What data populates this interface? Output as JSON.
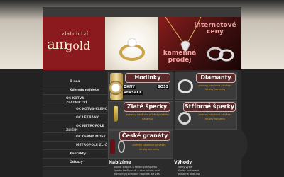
{
  "header": {
    "logo_small": "zlatnictví",
    "logo_am": "am",
    "logo_gold": "gold",
    "promo_line1": "internetové",
    "promo_line2": "ceny",
    "promo_line3": "kamenná",
    "promo_line4": "prodej"
  },
  "nav": {
    "items": [
      {
        "label": "O nás"
      },
      {
        "label": "Kde nás najdete"
      },
      {
        "label": "OC KOTVA-"
      },
      {
        "label": "ZLATNICTVÍ"
      },
      {
        "label": "OC KOTVA-KLENOTY"
      },
      {
        "label": "OC LETŇANY"
      },
      {
        "label": "OC METROPOLE"
      },
      {
        "label": "ZLIČÍN"
      },
      {
        "label": "OC ČERNÝ MOST"
      },
      {
        "label": "METROPOLE ZLIČÍN"
      },
      {
        "label": "Kontakty"
      },
      {
        "label": "Odkazy"
      }
    ]
  },
  "cards": {
    "hodinky": {
      "title": "Hodinky"
    },
    "diamanty": {
      "title": "Diamanty",
      "links": "prsteny  náušnice  přívěsky  řetízky  náramky"
    },
    "zlate": {
      "title": "Zlaté šperky",
      "links": "prsteny  náušnice  přívěsky  řetízky  náramky"
    },
    "stribrne": {
      "title": "Stříbrné šperky",
      "links": "prsteny  náušnice  přívěsky  řetízky  náramky"
    },
    "ceske": {
      "title": "České granáty",
      "links": "prsteny  náušnice  přívěsky  řetízky  náramky"
    }
  },
  "brands": [
    "DKNY",
    "BOSS",
    "VERSACE"
  ],
  "bottom": {
    "nabizime_title": "Nabízíme",
    "nabizime_lines": [
      "prodej zlatých a stříbrných šperků",
      "šperky ke škrtnutí a chirurgické oceli",
      "diamanty (speciální nabídka dle vaší"
    ],
    "vyhody_title": "Výhody",
    "vyhody_lines": [
      "velký výběr",
      "široký sortiment",
      "odborná obsluha"
    ]
  }
}
